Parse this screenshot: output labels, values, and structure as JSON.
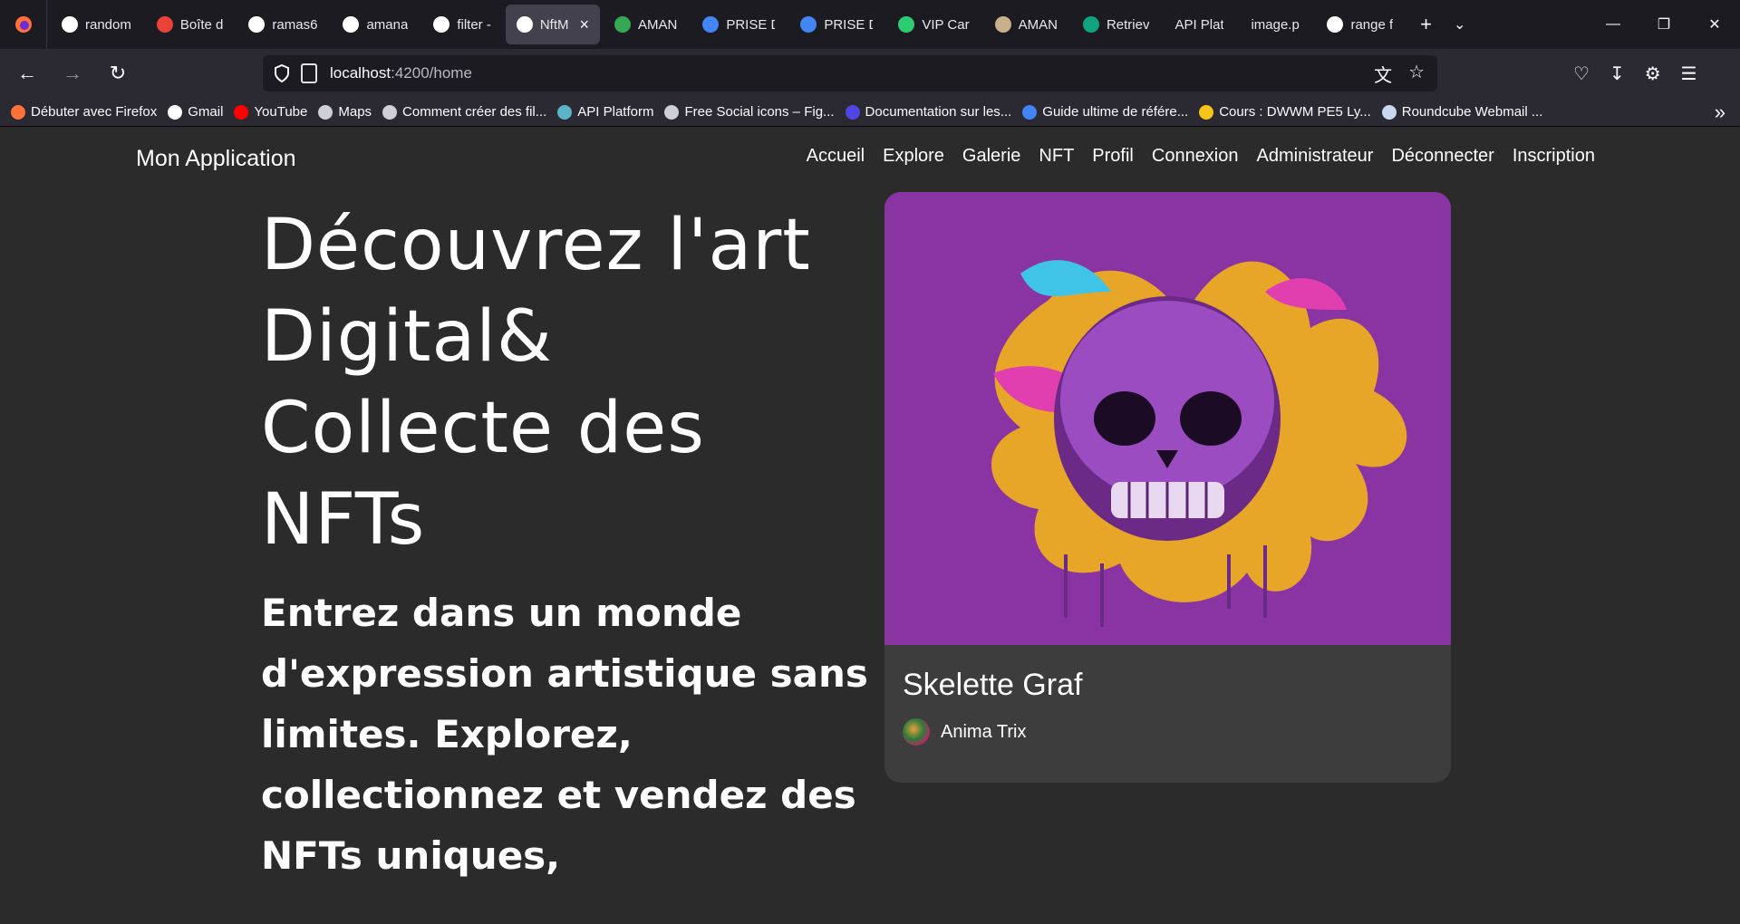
{
  "browser": {
    "tabs": [
      {
        "label": "random",
        "color": "#ffffff",
        "icon": "google-icon"
      },
      {
        "label": "Boîte d",
        "color": "#ea4335",
        "icon": "gmail-icon"
      },
      {
        "label": "ramas6",
        "color": "#ffffff",
        "icon": "github-icon"
      },
      {
        "label": "amana",
        "color": "#ffffff",
        "icon": "github-icon"
      },
      {
        "label": "filter -",
        "color": "#ffffff",
        "icon": "mdn-icon"
      },
      {
        "label": "NftM",
        "color": "#ffffff",
        "icon": "angular-icon",
        "active": true
      },
      {
        "label": "AMAN",
        "color": "#34a853",
        "icon": "drive-icon"
      },
      {
        "label": "PRISE D",
        "color": "#4285f4",
        "icon": "docs-icon"
      },
      {
        "label": "PRISE D",
        "color": "#4285f4",
        "icon": "docs-icon"
      },
      {
        "label": "VIP Car",
        "color": "#2ecc71",
        "icon": "app-icon"
      },
      {
        "label": "AMAN",
        "color": "#c8b08a",
        "icon": "app-icon"
      },
      {
        "label": "Retriev",
        "color": "#10a37f",
        "icon": "chatgpt-icon"
      },
      {
        "label": "API Platform",
        "color": "",
        "icon": ""
      },
      {
        "label": "image.png",
        "color": "",
        "icon": ""
      },
      {
        "label": "range f",
        "color": "#ffffff",
        "icon": "google-icon"
      }
    ],
    "url_host": "localhost",
    "url_path": ":4200/home",
    "bookmarks": [
      {
        "label": "Débuter avec Firefox",
        "color": "#ff7139"
      },
      {
        "label": "Gmail",
        "color": "#ffffff"
      },
      {
        "label": "YouTube",
        "color": "#ff0000"
      },
      {
        "label": "Maps",
        "color": "#cfcfd8"
      },
      {
        "label": "Comment créer des fil...",
        "color": "#cfcfd8"
      },
      {
        "label": "API Platform",
        "color": "#5ab4c7"
      },
      {
        "label": "Free Social icons – Fig...",
        "color": "#cfcfd8"
      },
      {
        "label": "Documentation sur les...",
        "color": "#4f46e5"
      },
      {
        "label": "Guide ultime de référe...",
        "color": "#4285f4"
      },
      {
        "label": "Cours : DWWM PE5 Ly...",
        "color": "#f5c518"
      },
      {
        "label": "Roundcube Webmail ...",
        "color": "#c8d9ef"
      }
    ]
  },
  "app": {
    "brand": "Mon Application",
    "menu": [
      "Accueil",
      "Explore",
      "Galerie",
      "NFT",
      "Profil",
      "Connexion",
      "Administrateur",
      "Déconnecter",
      "Inscription"
    ],
    "hero_title": "Découvrez l'art Digital& Collecte des NFTs",
    "hero_subtitle": "Entrez dans un monde d'expression artistique sans limites. Explorez, collectionnez et vendez des NFTs uniques,",
    "card": {
      "title": "Skelette Graf",
      "creator": "Anima Trix"
    }
  }
}
